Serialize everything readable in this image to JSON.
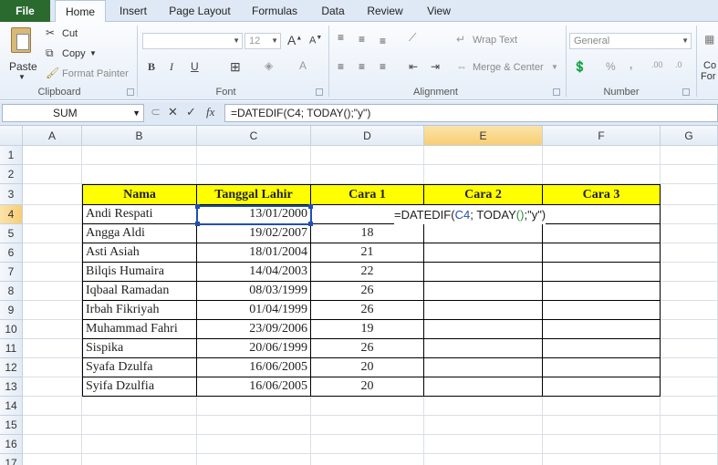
{
  "tabs": [
    "File",
    "Home",
    "Insert",
    "Page Layout",
    "Formulas",
    "Data",
    "Review",
    "View"
  ],
  "ribbon": {
    "clipboard": {
      "paste": "Paste",
      "cut": "Cut",
      "copy": "Copy",
      "format_painter": "Format Painter",
      "label": "Clipboard"
    },
    "font": {
      "size": "12",
      "label": "Font",
      "bold": "B",
      "italic": "I",
      "underline": "U"
    },
    "alignment": {
      "wrap_text": "Wrap Text",
      "merge_center": "Merge & Center",
      "label": "Alignment"
    },
    "number": {
      "format": "General",
      "percent": "%",
      "comma": ",",
      "label": "Number"
    },
    "styles_partial": [
      "Co",
      "For"
    ]
  },
  "formula_bar": {
    "name_box": "SUM",
    "fx": "fx",
    "formula": "=DATEDIF(C4; TODAY();\"y\")"
  },
  "columns": [
    "A",
    "B",
    "C",
    "D",
    "E",
    "F",
    "G"
  ],
  "rows": [
    "1",
    "2",
    "3",
    "4",
    "5",
    "6",
    "7",
    "8",
    "9",
    "10",
    "11",
    "12",
    "13",
    "14",
    "15",
    "16",
    "17"
  ],
  "table": {
    "headers": [
      "Nama",
      "Tanggal Lahir",
      "Cara 1",
      "Cara 2",
      "Cara 3"
    ],
    "editing_formula": {
      "prefix": "=DATEDIF(",
      "ref": "C4",
      "mid": "; TODAY",
      "open": "(",
      "close": ")",
      "suffix": ";\"y\")"
    },
    "data": [
      [
        "Andi Respati",
        "13/01/2000",
        ""
      ],
      [
        "Angga Aldi",
        "19/02/2007",
        "18"
      ],
      [
        "Asti Asiah",
        "18/01/2004",
        "21"
      ],
      [
        "Bilqis Humaira",
        "14/04/2003",
        "22"
      ],
      [
        "Iqbaal Ramadan",
        "08/03/1999",
        "26"
      ],
      [
        "Irbah Fikriyah",
        "01/04/1999",
        "26"
      ],
      [
        "Muhammad Fahri",
        "23/09/2006",
        "19"
      ],
      [
        "Sispika",
        "20/06/1999",
        "26"
      ],
      [
        "Syafa Dzulfa",
        "16/06/2005",
        "20"
      ],
      [
        "Syifa Dzulfia",
        "16/06/2005",
        "20"
      ]
    ]
  }
}
